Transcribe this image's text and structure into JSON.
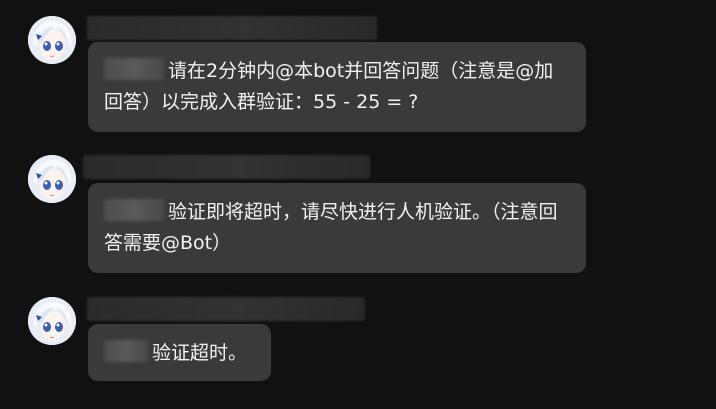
{
  "messages": [
    {
      "sender": "",
      "text": "请在2分钟内@本bot并回答问题（注意是@加回答）以完成入群验证：55 - 25 = ?"
    },
    {
      "sender": "",
      "text": "验证即将超时，请尽快进行人机验证。（注意回答需要@Bot）"
    },
    {
      "sender": "",
      "text": "验证超时。"
    }
  ]
}
